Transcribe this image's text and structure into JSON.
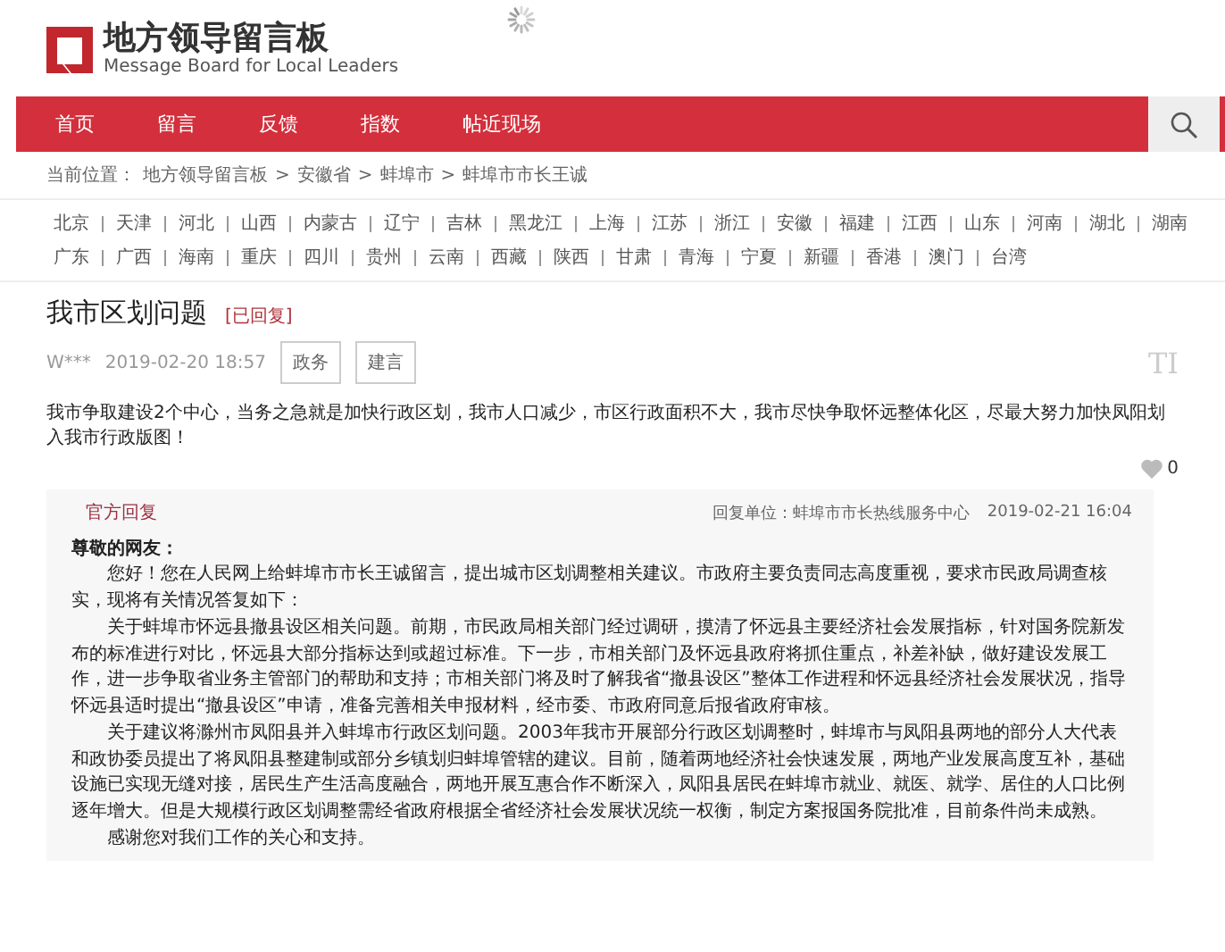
{
  "header": {
    "logo_title": "地方领导留言板",
    "logo_subtitle": "Message Board for Local Leaders"
  },
  "nav": {
    "items": [
      {
        "label": "首页",
        "selected": false
      },
      {
        "label": "留言",
        "selected": false
      },
      {
        "label": "反馈",
        "selected": false
      },
      {
        "label": "指数",
        "selected": false
      },
      {
        "label": "帖近现场",
        "selected": false
      }
    ]
  },
  "breadcrumb": {
    "label": "当前位置：",
    "items": [
      "地方领导留言板",
      "安徽省",
      "蚌埠市",
      "蚌埠市市长王诚"
    ],
    "separator": ">"
  },
  "regions": [
    [
      "北京",
      "天津",
      "河北",
      "山西",
      "内蒙古",
      "辽宁",
      "吉林",
      "黑龙江",
      "上海",
      "江苏",
      "浙江",
      "安徽",
      "福建",
      "江西",
      "山东",
      "河南",
      "湖北",
      "湖南"
    ],
    [
      "广东",
      "广西",
      "海南",
      "重庆",
      "四川",
      "贵州",
      "云南",
      "西藏",
      "陕西",
      "甘肃",
      "青海",
      "宁夏",
      "新疆",
      "香港",
      "澳门",
      "台湾"
    ]
  ],
  "post": {
    "title": "我市区划问题",
    "status": "[已回复]",
    "author": "W***",
    "time": "2019-02-20 18:57",
    "tags": [
      "政务",
      "建言"
    ],
    "font_toggle": "TI",
    "body": "我市争取建设2个中心，当务之急就是加快行政区划，我市人口减少，市区行政面积不大，我市尽快争取怀远整体化区，尽最大努力加快凤阳划入我市行政版图！",
    "likes": "0"
  },
  "reply": {
    "label": "官方回复",
    "unit": "回复单位：蚌埠市市长热线服务中心",
    "time": "2019-02-21 16:04",
    "greeting": "尊敬的网友：",
    "paragraphs": [
      "您好！您在人民网上给蚌埠市市长王诚留言，提出城市区划调整相关建议。市政府主要负责同志高度重视，要求市民政局调查核实，现将有关情况答复如下：",
      "关于蚌埠市怀远县撤县设区相关问题。前期，市民政局相关部门经过调研，摸清了怀远县主要经济社会发展指标，针对国务院新发布的标准进行对比，怀远县大部分指标达到或超过标准。下一步，市相关部门及怀远县政府将抓住重点，补差补缺，做好建设发展工作，进一步争取省业务主管部门的帮助和支持；市相关部门将及时了解我省“撤县设区”整体工作进程和怀远县经济社会发展状况，指导怀远县适时提出“撤县设区”申请，准备完善相关申报材料，经市委、市政府同意后报省政府审核。",
      "关于建议将滁州市凤阳县并入蚌埠市行政区划问题。2003年我市开展部分行政区划调整时，蚌埠市与凤阳县两地的部分人大代表和政协委员提出了将凤阳县整建制或部分乡镇划归蚌埠管辖的建议。目前，随着两地经济社会快速发展，两地产业发展高度互补，基础设施已实现无缝对接，居民生产生活高度融合，两地开展互惠合作不断深入，凤阳县居民在蚌埠市就业、就医、就学、居住的人口比例逐年增大。但是大规模行政区划调整需经省政府根据全省经济社会发展状况统一权衡，制定方案报国务院批准，目前条件尚未成熟。",
      "感谢您对我们工作的关心和支持。"
    ]
  }
}
